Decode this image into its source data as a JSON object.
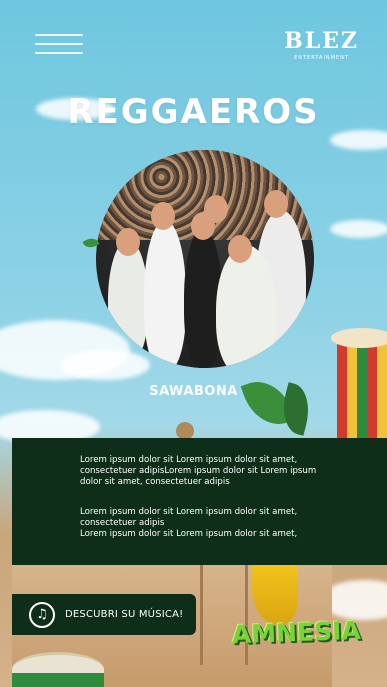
{
  "header": {
    "menu_icon": "hamburger-icon",
    "logo_text": "BLEZ",
    "logo_subtext": "ENTERTAINMENT"
  },
  "artist": {
    "title": "REGGAEROS",
    "subtitle": "SAWABONA"
  },
  "content": {
    "paragraph_1": "Lorem ipsum dolor sit Lorem ipsum dolor sit amet, consectetuer adipisLorem ipsum dolor sit Lorem ipsum dolor sit amet, consectetuer adipis",
    "paragraph_2": "Lorem ipsum dolor sit Lorem ipsum dolor sit amet, consectetuer adipis\nLorem ipsum dolor sit Lorem ipsum dolor sit amet,"
  },
  "cta": {
    "label": "DESCUBRI SU MÚSICA!",
    "icon": "music-note-icon"
  },
  "footer_brand": {
    "text": "AMNESIA"
  },
  "colors": {
    "sky": "#6ec7df",
    "panel": "#0e2e1a",
    "accent_green": "#7cd13a"
  }
}
